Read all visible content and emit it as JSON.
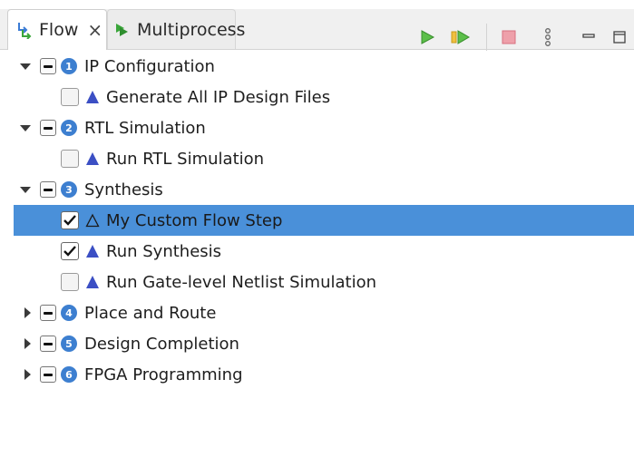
{
  "tabs": [
    {
      "label": "Flow",
      "close": "×",
      "icon": "flow-arrows-icon",
      "active": true
    },
    {
      "label": "Multiprocess",
      "icon": "multiprocess-icon",
      "active": false
    }
  ],
  "toolbar": {
    "run": "run-icon",
    "run_step": "run-step-icon",
    "stop": "stop-icon",
    "more": "more-options-icon",
    "minimize": "minimize-icon",
    "maximize": "maximize-icon"
  },
  "tree": {
    "stages": [
      {
        "num": "1",
        "label": "IP Configuration",
        "expanded": true
      },
      {
        "num": "2",
        "label": "RTL Simulation",
        "expanded": true
      },
      {
        "num": "3",
        "label": "Synthesis",
        "expanded": true
      },
      {
        "num": "4",
        "label": "Place and Route",
        "expanded": false
      },
      {
        "num": "5",
        "label": "Design Completion",
        "expanded": false
      },
      {
        "num": "6",
        "label": "FPGA Programming",
        "expanded": false
      }
    ],
    "steps": [
      {
        "label": "Generate All IP Design Files",
        "checked": false
      },
      {
        "label": "Run RTL Simulation",
        "checked": false
      },
      {
        "label": "My Custom Flow Step",
        "checked": true,
        "selected": true
      },
      {
        "label": "Run Synthesis",
        "checked": true
      },
      {
        "label": "Run Gate-level Netlist Simulation",
        "checked": false
      }
    ]
  },
  "colors": {
    "selection": "#4a90d9",
    "badge": "#3d7fd0",
    "step_icon": "#3b4fc4",
    "run_green": "#3aa63a",
    "stop_red": "#e06a78"
  }
}
